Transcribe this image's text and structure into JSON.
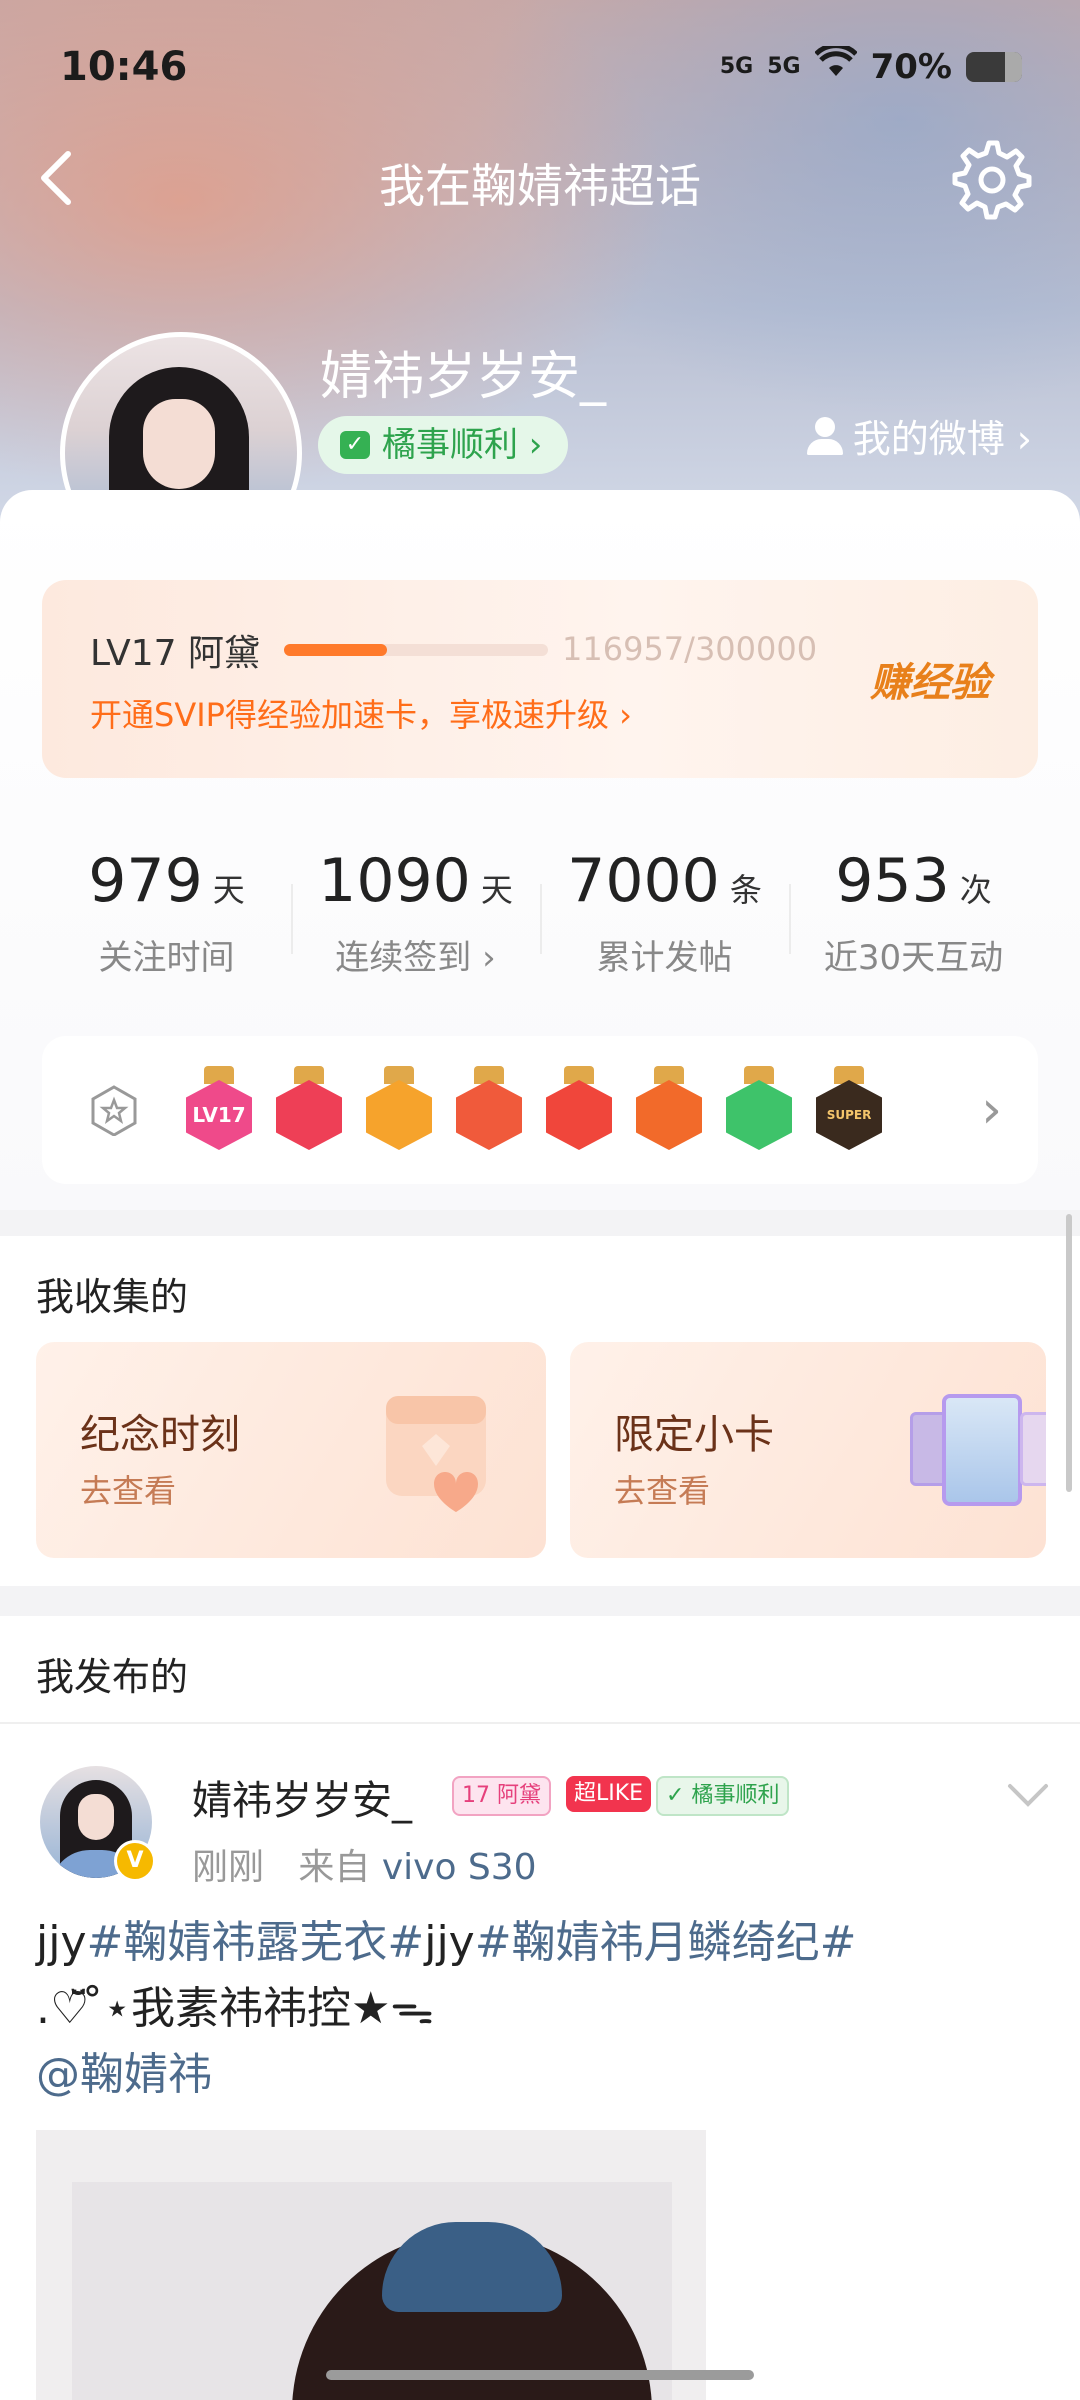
{
  "status_bar": {
    "time": "10:46",
    "signal1": "5G",
    "signal2": "5G",
    "battery": "70%"
  },
  "nav": {
    "title": "我在鞠婧祎超话"
  },
  "profile": {
    "username": "婧祎岁岁安_",
    "tag": "橘事顺利 ›",
    "my_weibo": "我的微博 ›"
  },
  "level": {
    "label": "LV17 阿黛",
    "progress_text": "116957/300000",
    "progress_fraction": 0.39,
    "promo": "开通SVIP得经验加速卡，享极速升级 ›",
    "earn": "赚经验"
  },
  "stats": [
    {
      "num": "979",
      "unit": "天",
      "label": "关注时间"
    },
    {
      "num": "1090",
      "unit": "天",
      "label": "连续签到 ›"
    },
    {
      "num": "7000",
      "unit": "条",
      "label": "累计发帖"
    },
    {
      "num": "953",
      "unit": "次",
      "label": "近30天互动"
    }
  ],
  "badges": {
    "items": [
      {
        "name": "lv17-badge",
        "text": "LV17",
        "color": "#ef4a8a"
      },
      {
        "name": "trophy-badge",
        "text": "",
        "color": "#ee3f56"
      },
      {
        "name": "crown-badge",
        "text": "",
        "color": "#f6a32c"
      },
      {
        "name": "cat-badge-1",
        "text": "",
        "color": "#f05a3b"
      },
      {
        "name": "cat-badge-2",
        "text": "",
        "color": "#f0463b"
      },
      {
        "name": "cat-badge-3",
        "text": "",
        "color": "#f26a2a"
      },
      {
        "name": "hand-badge",
        "text": "",
        "color": "#3ec36a"
      },
      {
        "name": "super-badge",
        "text": "SUPER",
        "color": "#3a2a1e"
      }
    ]
  },
  "collection": {
    "title": "我收集的",
    "cards": [
      {
        "title": "纪念时刻",
        "sub": "去查看"
      },
      {
        "title": "限定小卡",
        "sub": "去查看"
      }
    ]
  },
  "posts_section": {
    "title": "我发布的"
  },
  "post": {
    "name": "婧祎岁岁安_",
    "level_pill": "17 阿黛",
    "like_pill": "超LIKE",
    "tag_pill": "橘事顺利",
    "time": "刚刚",
    "from": "来自",
    "device": "vivo S30",
    "line1_a": "jjy",
    "line1_tag1": "#鞠婧祎露芜衣#",
    "line1_b": "jjy",
    "line1_tag2": "#鞠婧祎月鳞绮纪#",
    "line2": ".♡̆̈ ̊⋆我素祎祎控★ᯓ",
    "mention": "@鞠婧祎"
  },
  "colors": {
    "accent_orange": "#ff6d19",
    "link_blue": "#4d6b8c",
    "green_tag": "#35b153",
    "verified_gold": "#f6b900"
  }
}
